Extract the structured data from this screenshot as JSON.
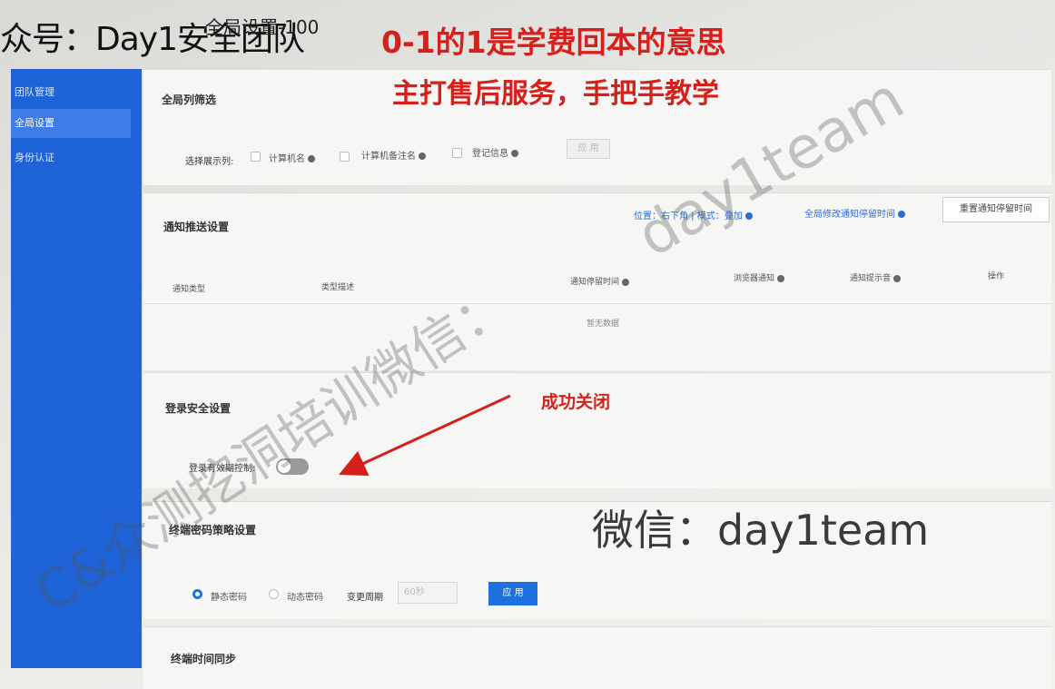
{
  "header": {
    "account": "众号：Day1安全团队",
    "breadcrumb": "全局设置-100"
  },
  "captions": {
    "line1": "0-1的1是学费回本的意思",
    "line2": "主打售后服务，手把手教学",
    "arrow_note": "成功关闭"
  },
  "sidebar": {
    "items": [
      {
        "label": "团队管理",
        "active": false
      },
      {
        "label": "全局设置",
        "active": true
      },
      {
        "label": "身份认证",
        "active": false
      }
    ]
  },
  "column_filter": {
    "title": "全局列筛选",
    "select_label": "选择展示列:",
    "options": [
      "计算机名",
      "计算机备注名",
      "登记信息"
    ],
    "apply_button": "应 用"
  },
  "notify": {
    "title": "通知推送设置",
    "position_link": "位置：右下角 | 模式：叠加",
    "global_link": "全局修改通知停留时间",
    "reset_button": "重置通知停留时间",
    "columns": [
      "通知类型",
      "类型描述",
      "通知停留时间",
      "浏览器通知",
      "通知提示音",
      "操作"
    ],
    "empty_text": "暂无数据"
  },
  "login_security": {
    "title": "登录安全设置",
    "toggle_label": "登录有效期控制:",
    "toggle_on": false
  },
  "password_policy": {
    "title": "终端密码策略设置",
    "radio_static": "静态密码",
    "radio_dynamic": "动态密码",
    "period_label": "变更周期",
    "period_placeholder": "60秒",
    "apply_button": "应 用",
    "selected": "静态密码"
  },
  "time_sync": {
    "title": "终端时间同步"
  },
  "watermarks": {
    "en": "day1team",
    "cn": "C&众测挖洞培训微信：",
    "wechat": "微信：day1team"
  },
  "colors": {
    "sidebar": "#1e63d8",
    "caption_red": "#d6201c",
    "primary_blue": "#1e6fe0"
  }
}
